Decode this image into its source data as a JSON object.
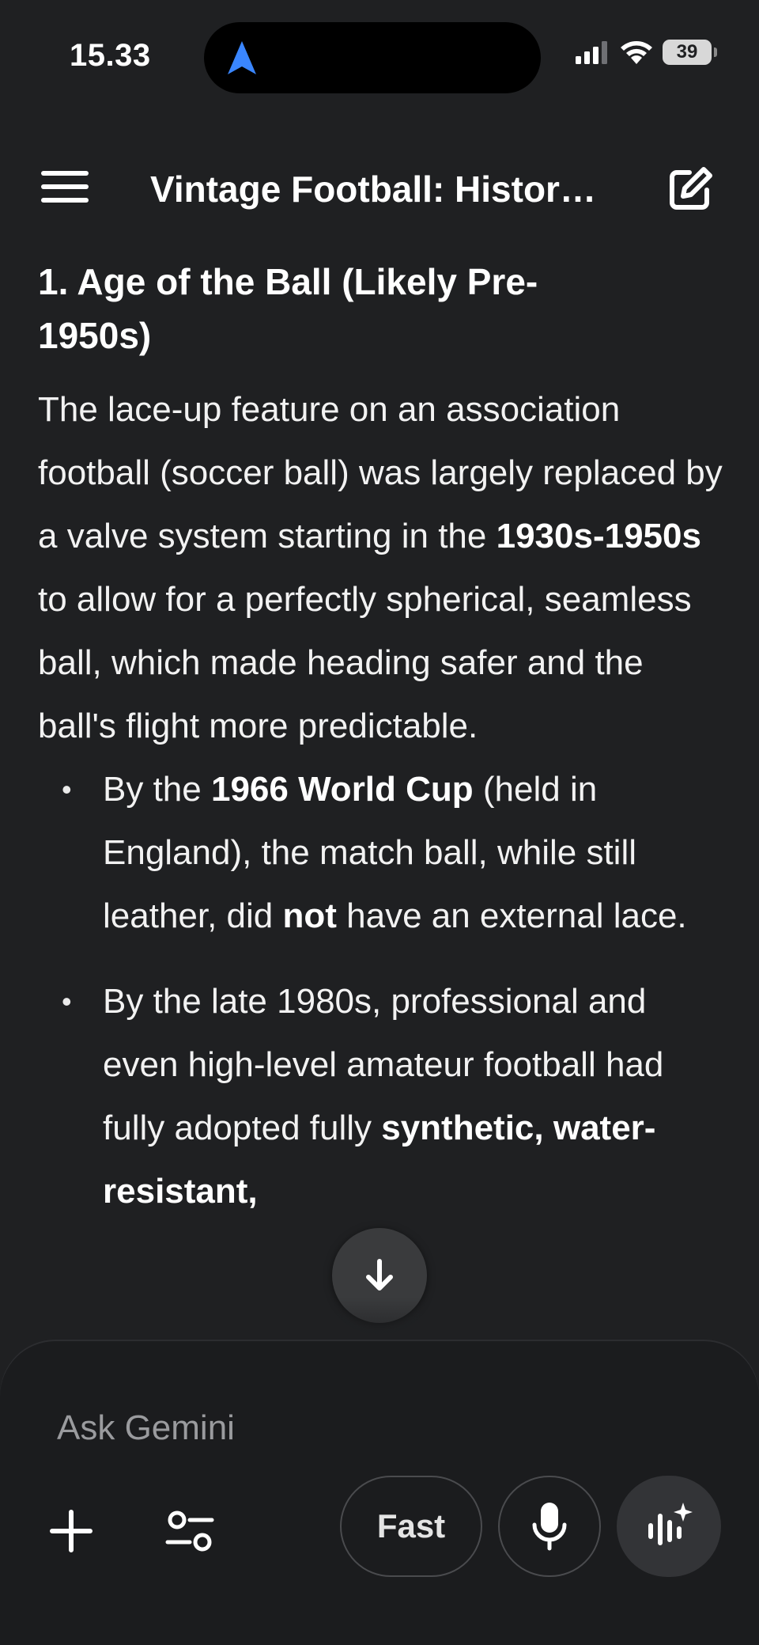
{
  "status_bar": {
    "time": "15.33",
    "battery": "39"
  },
  "header": {
    "title": "Vintage Football: Histor…"
  },
  "content": {
    "heading": "1. Age of the Ball (Likely Pre-1950s)",
    "paragraph": {
      "p1": "The lace-up feature on an association football (soccer ball) was largely replaced by a valve system starting in the ",
      "p1_bold": "1930s-1950s",
      "p2": " to allow for a perfectly spherical, seamless ball, which made heading safer and the ball's flight more predictable."
    },
    "bullets": [
      {
        "a": "By the ",
        "b_bold": "1966 World Cup",
        "c": " (held in England), the match ball, while still leather, did ",
        "d_bold": "not",
        "e": " have an external lace."
      },
      {
        "a": "By the late 1980s, professional and even high-level amateur football had f",
        "hidden": "ully",
        "b": " adopted fully ",
        "c_bold": "synthetic, water-resistant,"
      }
    ]
  },
  "composer": {
    "placeholder": "Ask Gemini",
    "mode_label": "Fast"
  }
}
